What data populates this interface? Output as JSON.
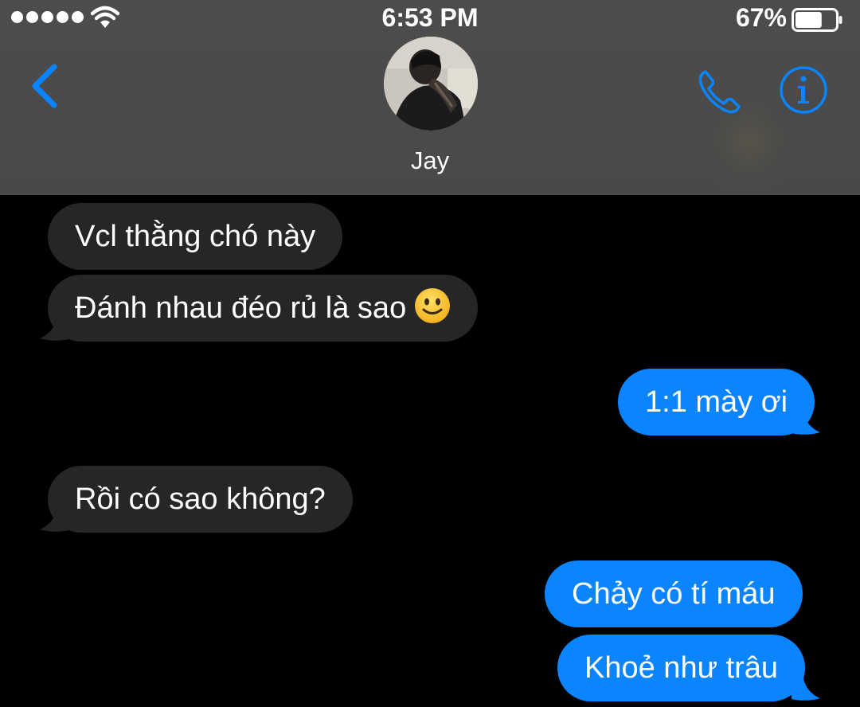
{
  "status_bar": {
    "time": "6:53 PM",
    "battery_percent": "67%",
    "signal_dots": 5,
    "battery_level": 0.67
  },
  "header": {
    "contact_name": "Jay",
    "back_icon": "chevron-left-icon",
    "call_icon": "phone-icon",
    "info_icon": "info-icon",
    "accent_color": "#0a84ff"
  },
  "messages": [
    {
      "direction": "received",
      "text": "Vcl thằng chó này"
    },
    {
      "direction": "received",
      "text": "Đánh nhau đéo rủ là sao",
      "emoji": "slightly-smiling-face-emoji"
    },
    {
      "direction": "sent",
      "text": "1:1 mày ơi"
    },
    {
      "direction": "received",
      "text": "Rồi có sao không?"
    },
    {
      "direction": "sent",
      "text": "Chảy có tí máu"
    },
    {
      "direction": "sent",
      "text": "Khoẻ như trâu"
    }
  ],
  "colors": {
    "sent_bubble": "#0a84ff",
    "received_bubble": "#262628",
    "header_bg": "#4a4a4a",
    "background": "#000000"
  }
}
